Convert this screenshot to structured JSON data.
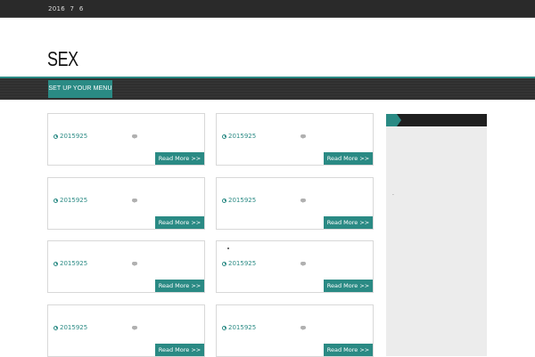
{
  "topbar": {
    "date": "2016 7 6"
  },
  "site": {
    "title": "SEX"
  },
  "nav": {
    "items": [
      {
        "label": "SET UP YOUR MENU"
      }
    ]
  },
  "posts": [
    {
      "date": "2015925",
      "read_more": "Read More >>"
    },
    {
      "date": "2015925",
      "read_more": "Read More >>"
    },
    {
      "date": "2015925",
      "read_more": "Read More >>"
    },
    {
      "date": "2015925",
      "read_more": "Read More >>"
    },
    {
      "date": "2015925",
      "read_more": "Read More >>"
    },
    {
      "date": "2015925",
      "read_more": "Read More >>"
    },
    {
      "date": "2015925",
      "read_more": "Read More >>"
    },
    {
      "date": "2015925",
      "read_more": "Read More >>"
    }
  ],
  "sidebar": {
    "text": "."
  },
  "icons": {
    "date": "clock-icon",
    "comments": "comment-icon"
  },
  "colors": {
    "accent": "#2a8a84",
    "topbar": "#2a2a2a",
    "nav": "#2f2f2f",
    "sidebar": "#ececec"
  }
}
